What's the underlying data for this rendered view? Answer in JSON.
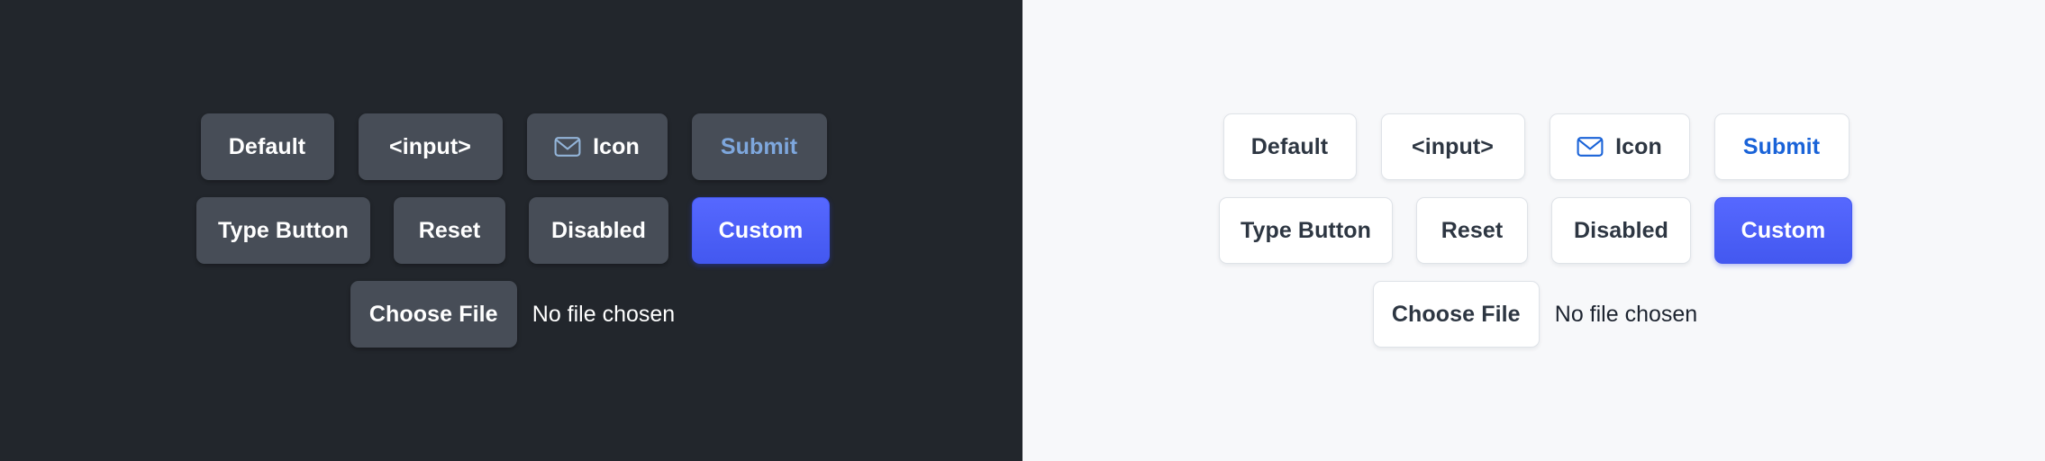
{
  "panels": [
    {
      "theme": "dark",
      "background": "#22262c",
      "rows": [
        {
          "buttons": [
            {
              "label": "Default",
              "variant": "default",
              "icon": null
            },
            {
              "label": "<input>",
              "variant": "input",
              "icon": null
            },
            {
              "label": "Icon",
              "variant": "icon",
              "icon": "envelope-icon"
            },
            {
              "label": "Submit",
              "variant": "submit",
              "icon": null
            }
          ]
        },
        {
          "buttons": [
            {
              "label": "Type Button",
              "variant": "type",
              "icon": null
            },
            {
              "label": "Reset",
              "variant": "reset",
              "icon": null
            },
            {
              "label": "Disabled",
              "variant": "disabled",
              "icon": null
            },
            {
              "label": "Custom",
              "variant": "custom",
              "icon": null
            }
          ]
        }
      ],
      "file": {
        "button_label": "Choose File",
        "status_text": "No file chosen"
      },
      "colors": {
        "surface": "#474d57",
        "text": "#ffffff",
        "submit_text": "#7ea7dd",
        "icon": "#93b4d8",
        "custom_bg": "#4f60f5"
      }
    },
    {
      "theme": "light",
      "background": "#f7f8fa",
      "rows": [
        {
          "buttons": [
            {
              "label": "Default",
              "variant": "default",
              "icon": null
            },
            {
              "label": "<input>",
              "variant": "input",
              "icon": null
            },
            {
              "label": "Icon",
              "variant": "icon",
              "icon": "envelope-icon"
            },
            {
              "label": "Submit",
              "variant": "submit",
              "icon": null
            }
          ]
        },
        {
          "buttons": [
            {
              "label": "Type Button",
              "variant": "type",
              "icon": null
            },
            {
              "label": "Reset",
              "variant": "reset",
              "icon": null
            },
            {
              "label": "Disabled",
              "variant": "disabled",
              "icon": null
            },
            {
              "label": "Custom",
              "variant": "custom",
              "icon": null
            }
          ]
        }
      ],
      "file": {
        "button_label": "Choose File",
        "status_text": "No file chosen"
      },
      "colors": {
        "surface": "#ffffff",
        "border": "#dfe3e8",
        "text": "#2d3642",
        "submit_text": "#1a63d8",
        "icon": "#1a63d8",
        "custom_bg": "#4f60f5"
      }
    }
  ]
}
